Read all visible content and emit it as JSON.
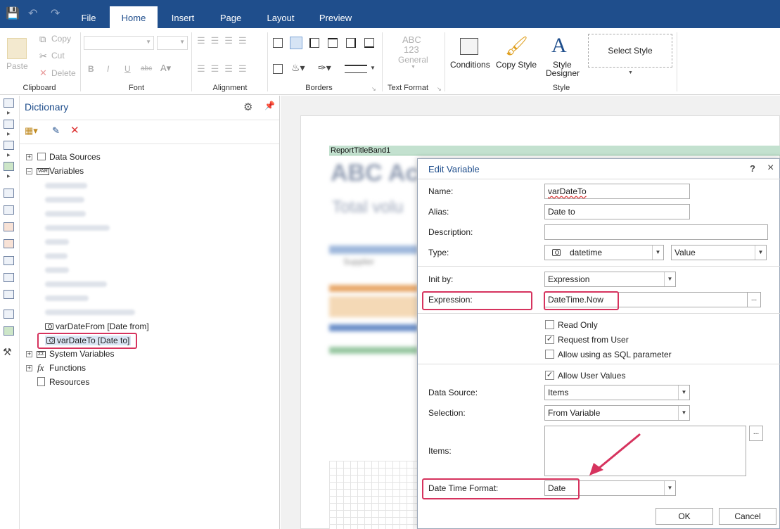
{
  "menu": {
    "tabs": [
      {
        "label": "File"
      },
      {
        "label": "Home"
      },
      {
        "label": "Insert"
      },
      {
        "label": "Page"
      },
      {
        "label": "Layout"
      },
      {
        "label": "Preview"
      }
    ],
    "active_tab": "Home"
  },
  "ribbon": {
    "clipboard": {
      "paste": "Paste",
      "copy": "Copy",
      "cut": "Cut",
      "delete": "Delete",
      "label": "Clipboard"
    },
    "font": {
      "label": "Font",
      "bold": "B",
      "italic": "I",
      "underline": "U",
      "strike": "abc"
    },
    "alignment": {
      "label": "Alignment"
    },
    "borders": {
      "label": "Borders"
    },
    "text_format": {
      "abc": "ABC",
      "num": "123",
      "general": "General",
      "label": "Text Format"
    },
    "style": {
      "conditions": "Conditions",
      "copy_style": "Copy Style",
      "style_designer_1": "Style",
      "style_designer_2": "Designer",
      "select_style": "Select Style",
      "label": "Style"
    }
  },
  "dictionary": {
    "title": "Dictionary",
    "tree": {
      "data_sources": "Data Sources",
      "variables": "Variables",
      "var_date_from": "varDateFrom [Date from]",
      "var_date_to": "varDateTo [Date to]",
      "system_variables": "System Variables",
      "functions": "Functions",
      "resources": "Resources"
    }
  },
  "canvas": {
    "band_title": "ReportTitleBand1",
    "blur_title": "ABC Ac",
    "blur_subtitle": "Total volu",
    "blur_row": "Supplier"
  },
  "dialog": {
    "title": "Edit Variable",
    "help": "?",
    "close": "×",
    "name_label": "Name:",
    "name_value": "varDateTo",
    "alias_label": "Alias:",
    "alias_value": "Date to",
    "description_label": "Description:",
    "description_value": "",
    "type_label": "Type:",
    "type_value": "datetime",
    "type_mode": "Value",
    "init_by_label": "Init by:",
    "init_by_value": "Expression",
    "expression_label": "Expression:",
    "expression_value": "DateTime.Now",
    "read_only": "Read Only",
    "request_from_user": "Request from User",
    "allow_sql": "Allow using as SQL parameter",
    "allow_user_values": "Allow User Values",
    "data_source_label": "Data Source:",
    "data_source_value": "Items",
    "selection_label": "Selection:",
    "selection_value": "From Variable",
    "items_label": "Items:",
    "date_time_format_label": "Date Time Format:",
    "date_time_format_value": "Date",
    "ok": "OK",
    "cancel": "Cancel",
    "ellipsis": "...",
    "check": "✓"
  },
  "colors": {
    "accent": "#1f4e8c",
    "highlight": "#d6335e",
    "band": "#c3e1cf"
  }
}
